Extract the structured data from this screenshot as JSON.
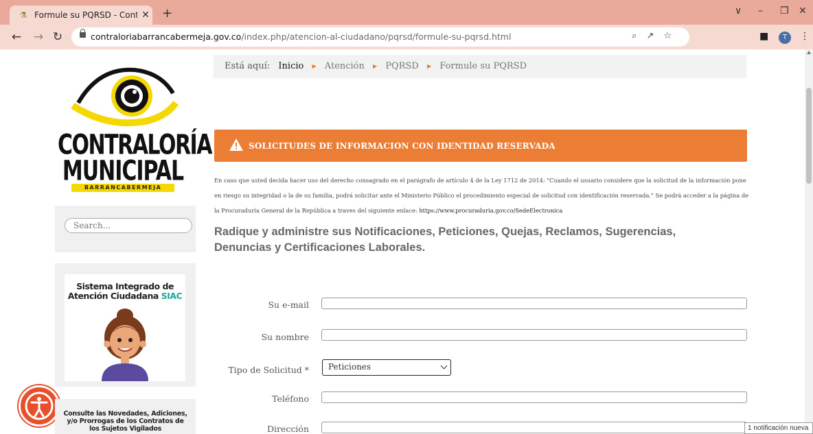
{
  "browser": {
    "tab_title": "Formule su PQRSD - Contraloría",
    "new_tab": "+",
    "url_host": "contraloriabarrancabermeja.gov.co",
    "url_path": "/index.php/atencion-al-ciudadano/pqrsd/formule-su-pqrsd.html",
    "profile_initial": "T"
  },
  "sidebar": {
    "logo_line1": "CONTRALORÍA",
    "logo_line2": "MUNICIPAL",
    "logo_band": "BARRANCABERMEJA",
    "search_placeholder": "Search...",
    "siac_title_1": "Sistema Integrado de",
    "siac_title_2": "Atención Ciudadana",
    "siac_highlight": "SIAC",
    "consult_text": "Consulte las Novedades, Adiciones, y/o Prorrogas de los Contratos de los Sujetos Vigilados"
  },
  "breadcrumb": {
    "prefix": "Está aquí:",
    "items": [
      "Inicio",
      "Atención",
      "PQRSD",
      "Formule su PQRSD"
    ]
  },
  "alert": {
    "text": "SOLICITUDES DE INFORMACION CON IDENTIDAD RESERVADA"
  },
  "notice": {
    "body": "En caso que usted decida hacer uso del derecho consagrado en el parágrafo de artículo 4 de la Ley 1712 de 2014: \"Cuando el usuario considere que la solicitud de la información pone en riesgo su integridad o la de su familia, podrá solicitar ante el Ministerio Público el procedimiento especial de solicitud con identificación reservada.\" Se podrá acceder a la página de la Procuraduría General de la República a traves del siguiente enlace: ",
    "link": "https://www.procuraduria.gov.co/SedeElectronica"
  },
  "heading": "Radique y administre sus Notificaciones, Peticiones, Quejas, Reclamos, Sugerencias, Denuncias y Certificaciones Laborales.",
  "form": {
    "email_label": "Su e-mail",
    "name_label": "Su nombre",
    "type_label": "Tipo de Solicitud *",
    "type_value": "Peticiones",
    "phone_label": "Teléfono",
    "address_label": "Dirección"
  },
  "toast": "1 notificación nueva",
  "colors": {
    "alert_orange": "#ec7d35",
    "breadcrumb_sep": "#e67e22",
    "siac_teal": "#1aa89c",
    "logo_yellow": "#f5d800",
    "accessibility_red": "#e8502c"
  }
}
